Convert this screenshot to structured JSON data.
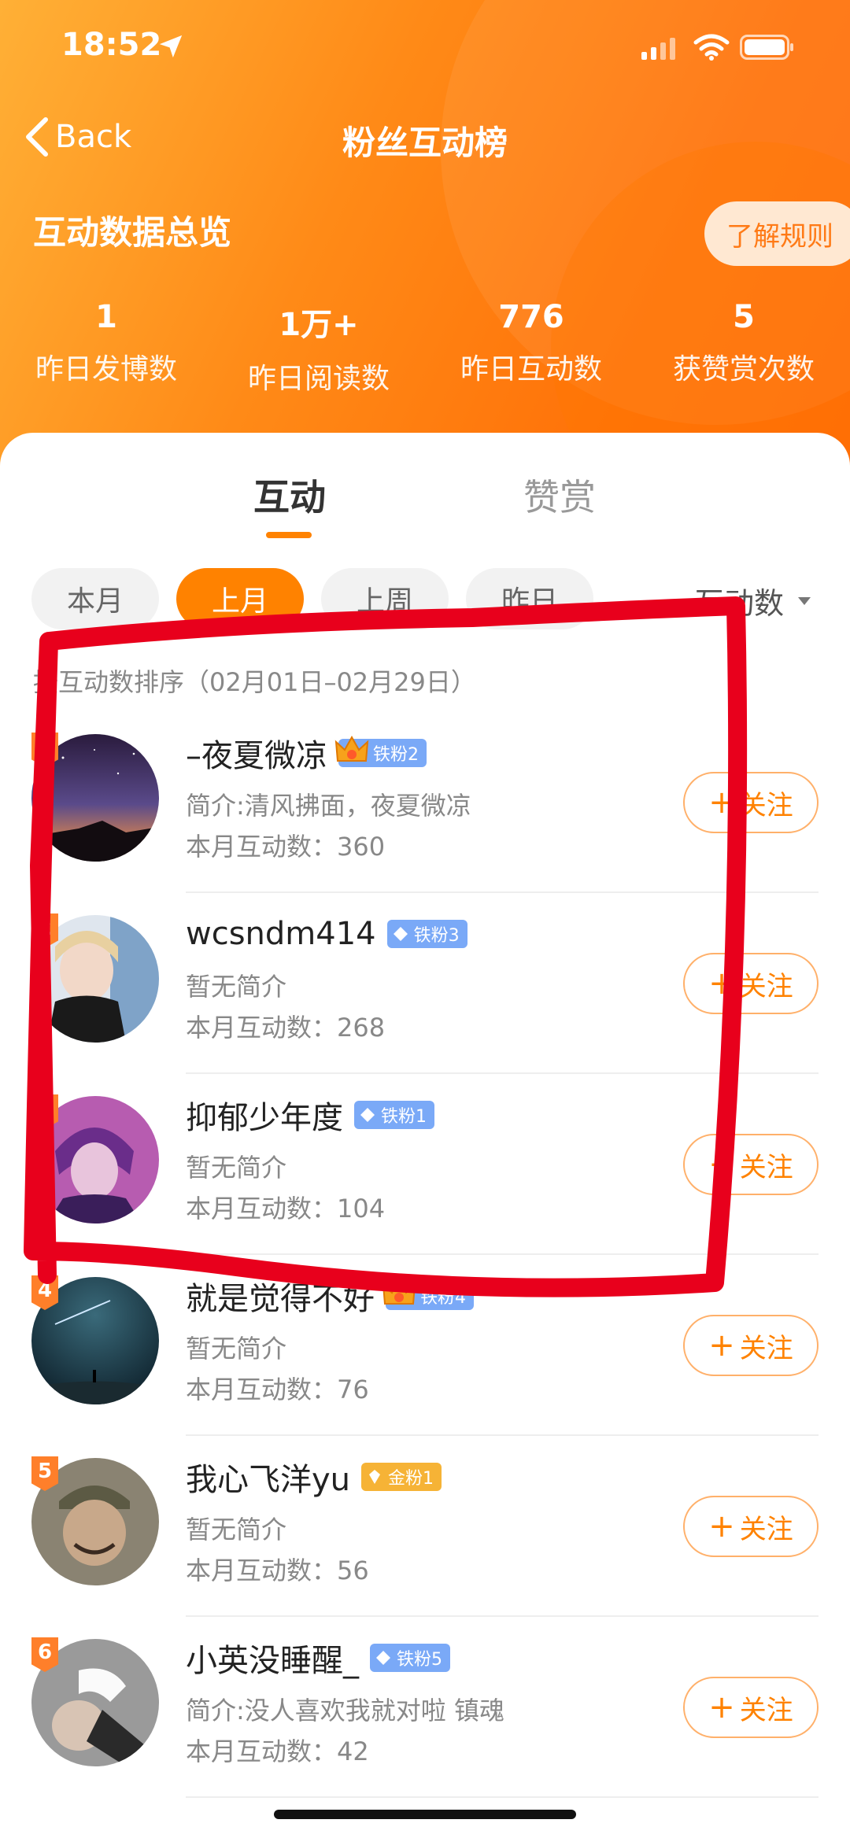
{
  "status_bar": {
    "time": "18:52"
  },
  "nav": {
    "back_label": "Back",
    "title": "粉丝互动榜"
  },
  "overview": {
    "title": "互动数据总览",
    "rules_button": "了解规则",
    "stats": [
      {
        "value": "1",
        "label": "昨日发博数"
      },
      {
        "value": "1万+",
        "label": "昨日阅读数"
      },
      {
        "value": "776",
        "label": "昨日互动数"
      },
      {
        "value": "5",
        "label": "获赞赏次数"
      }
    ]
  },
  "tabs": [
    {
      "label": "互动"
    },
    {
      "label": "赞赏"
    }
  ],
  "filters": [
    {
      "label": "本月"
    },
    {
      "label": "上月",
      "active": true
    },
    {
      "label": "上周"
    },
    {
      "label": "昨日"
    }
  ],
  "sort": {
    "label": "互动数"
  },
  "sort_description": "按互动数排序（02月01日–02月29日）",
  "fans": [
    {
      "rank": "1",
      "name": "–夜夏微凉",
      "badge": "铁粉2",
      "badge_type": "crown",
      "intro": "简介:清风拂面，夜夏微凉",
      "count": "本月互动数：360",
      "follow": "关注"
    },
    {
      "rank": "2",
      "name": "wcsndm414",
      "badge": "铁粉3",
      "badge_type": "iron",
      "intro": "暂无简介",
      "count": "本月互动数：268",
      "follow": "关注"
    },
    {
      "rank": "3",
      "name": "抑郁少年度",
      "badge": "铁粉1",
      "badge_type": "iron",
      "intro": "暂无简介",
      "count": "本月互动数：104",
      "follow": "关注"
    },
    {
      "rank": "4",
      "name": "就是觉得不好",
      "badge": "铁粉4",
      "badge_type": "crown",
      "intro": "暂无简介",
      "count": "本月互动数：76",
      "follow": "关注"
    },
    {
      "rank": "5",
      "name": "我心飞洋yu",
      "badge": "金粉1",
      "badge_type": "gold",
      "intro": "暂无简介",
      "count": "本月互动数：56",
      "follow": "关注"
    },
    {
      "rank": "6",
      "name": "小英没睡醒_",
      "badge": "铁粉5",
      "badge_type": "iron",
      "intro": "简介:没人喜欢我就对啦 镇魂",
      "count": "本月互动数：42",
      "follow": "关注"
    }
  ],
  "colors": {
    "accent": "#ff8200",
    "annotation": "#e8001c"
  }
}
